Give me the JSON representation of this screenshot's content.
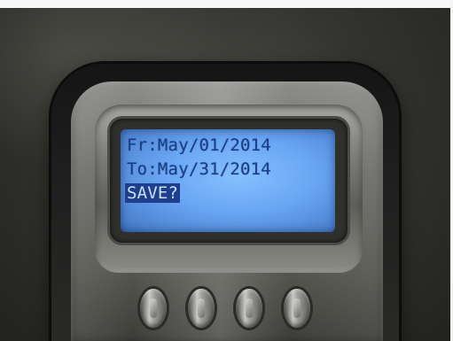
{
  "lcd": {
    "line1": "Fr:May/01/2014",
    "line2": "To:May/31/2014",
    "line3": "SAVE?"
  },
  "colors": {
    "lcd_background": "#6aa6f3",
    "lcd_text": "#1a3f86",
    "highlight_background": "#1f3f8e",
    "highlight_text": "#c9e0ff"
  },
  "buttons": [
    "keypad-button-1",
    "keypad-button-2",
    "keypad-button-3",
    "keypad-button-4"
  ]
}
